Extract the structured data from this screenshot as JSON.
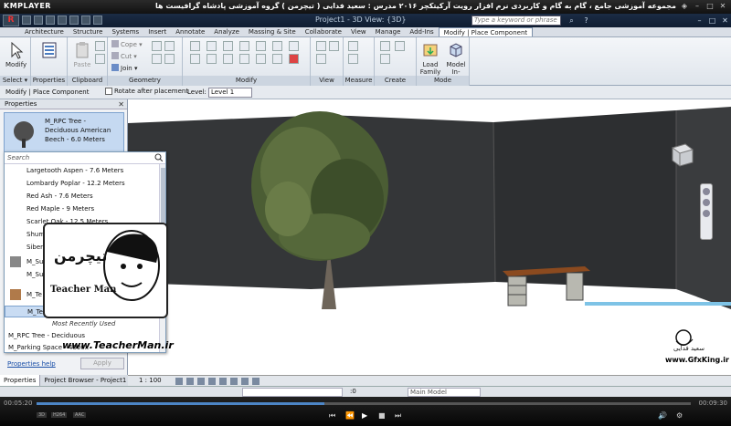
{
  "player": {
    "logo": "KMPLAYER",
    "title": "مجموعه آموزشی جامع ، گام به گام و کاربردی نرم افزار رویت آرکیتکچر ۲۰۱۶ مدرس : سعید فدایی ( تیچرمن ) گروه آموزشی پادشاه گرافیست ها",
    "time_current": "00:05:20",
    "time_total": "00:09:30",
    "progress_fraction": 0.44,
    "tags": [
      "3D",
      "H264",
      "AAC"
    ]
  },
  "revit": {
    "app_button": "R",
    "doc_title": "Project1 - 3D View: {3D}",
    "search_placeholder": "Type a keyword or phrase",
    "tabs": [
      "Architecture",
      "Structure",
      "Systems",
      "Insert",
      "Annotate",
      "Analyze",
      "Massing & Site",
      "Collaborate",
      "View",
      "Manage",
      "Add-Ins",
      "Modify | Place Component"
    ],
    "active_tab": "Modify | Place Component"
  },
  "ribbon": {
    "modify_label": "Modify",
    "select_label": "Select ▾",
    "properties_label": "Properties",
    "paste_label": "Paste",
    "clipboard_label": "Clipboard",
    "cope_label": "Cope ▾",
    "cut_label": "Cut ▾",
    "join_label": "Join ▾",
    "geometry_label": "Geometry",
    "modify_panel_label": "Modify",
    "view_label": "View",
    "measure_label": "Measure",
    "create_label": "Create",
    "load_family_label": "Load Family",
    "model_inplace_label": "Model In-place",
    "mode_label": "Mode"
  },
  "options_bar": {
    "context": "Modify | Place Component",
    "rotate_label": "Rotate after placement",
    "level_label": "Level:",
    "level_value": "Level 1"
  },
  "properties": {
    "header": "Properties",
    "type_name": "M_RPC Tree - Deciduous American Beech - 6.0 Meters",
    "help_link": "Properties help",
    "apply_label": "Apply",
    "tab_properties": "Properties",
    "tab_browser": "Project Browser - Project1"
  },
  "dropdown": {
    "search_placeholder": "Search",
    "items": [
      "Largetooth Aspen - 7.6 Meters",
      "Lombardy Poplar - 12.2 Meters",
      "Red Ash - 7.6 Meters",
      "Red Maple - 9 Meters",
      "Scarlet Oak - 12.5 Meters",
      "Shumard Oak - 9.1 Meters",
      "Siberian Crab Apple - 6.0 Meters"
    ],
    "partial_items": [
      "M_Su",
      "M_Su",
      "M_Te"
    ],
    "selected_item": "M_Termination - Wood - Rectangular",
    "group_label": "Most Recently Used",
    "recent_items": [
      "M_RPC Tree - Deciduous",
      "M_Parking Space - 4800x"
    ]
  },
  "watermarks": {
    "teacher_name": "Teacher Man",
    "teacher_site": "www.TeacherMan.ir",
    "gfx_name": "سعید فدایی",
    "gfx_site": "www.GfxKing.ir"
  },
  "view_control": {
    "scale": "1 : 100"
  },
  "status": {
    "coord": ":0",
    "model": "Main Model"
  },
  "colors": {
    "wall": "#343638",
    "ribbon_accent": "#c5d9f1",
    "seek_fill": "#4d86c7"
  }
}
